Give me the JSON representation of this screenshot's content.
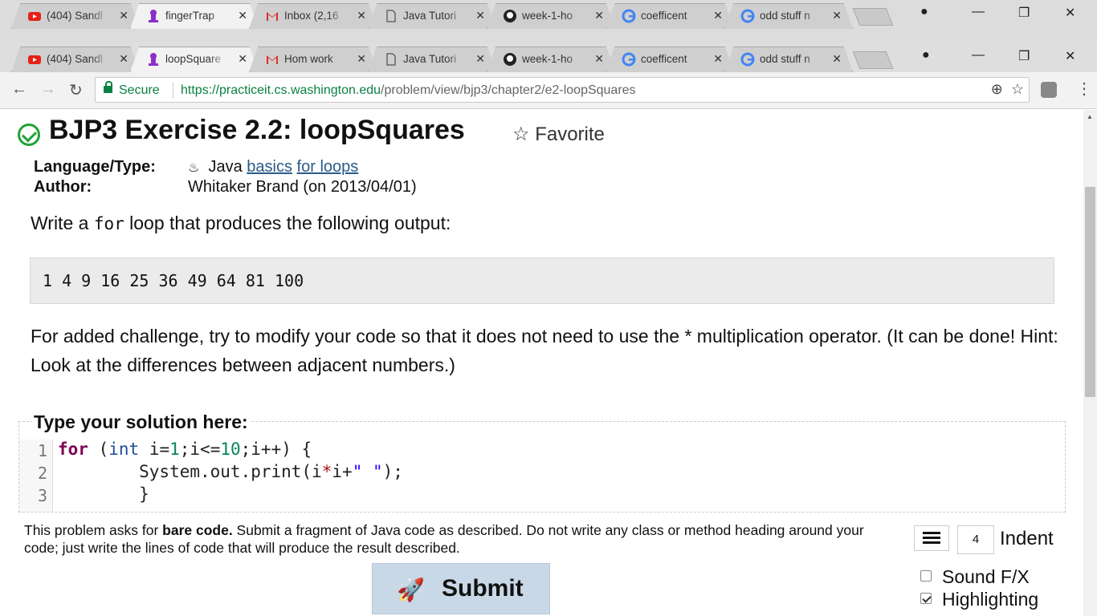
{
  "back_window": {
    "tabs": [
      {
        "title": "(404) Sandl",
        "icon": "youtube-icon"
      },
      {
        "title": "fingerTrap",
        "icon": "practiceit-icon",
        "active": true
      },
      {
        "title": "Inbox (2,16",
        "icon": "gmail-icon"
      },
      {
        "title": "Java Tutori",
        "icon": "page-icon"
      },
      {
        "title": "week-1-ho",
        "icon": "github-icon"
      },
      {
        "title": "coefficent",
        "icon": "google-icon"
      },
      {
        "title": "odd stuff n",
        "icon": "google-icon"
      }
    ]
  },
  "front_window": {
    "tabs": [
      {
        "title": "(404) Sandl",
        "icon": "youtube-icon"
      },
      {
        "title": "loopSquare",
        "icon": "practiceit-icon",
        "active": true
      },
      {
        "title": "Hom work",
        "icon": "gmail-icon"
      },
      {
        "title": "Java Tutori",
        "icon": "page-icon"
      },
      {
        "title": "week-1-ho",
        "icon": "github-icon"
      },
      {
        "title": "coefficent",
        "icon": "google-icon"
      },
      {
        "title": "odd stuff n",
        "icon": "google-icon"
      }
    ],
    "secure_label": "Secure",
    "url_scheme_host": "https://practiceit.cs.washington.edu",
    "url_path": "/problem/view/bjp3/chapter2/e2-loopSquares"
  },
  "page": {
    "title": "BJP3 Exercise 2.2: loopSquares",
    "favorite_label": "Favorite",
    "language_label": "Language/Type:",
    "language_value": "Java",
    "language_link1": "basics",
    "language_link2": "for loops",
    "author_label": "Author:",
    "author_value": "Whitaker Brand (on 2013/04/01)",
    "prompt_pre": "Write a ",
    "prompt_code": "for",
    "prompt_post": " loop that produces the following output:",
    "expected_output": "1 4 9 16 25 36 49 64 81 100",
    "challenge": "For added challenge, try to modify your code so that it does not need to use the * multiplication operator. (It can be done! Hint: Look at the differences between adjacent numbers.)",
    "solution_title": "Type your solution here:",
    "line_numbers": [
      "1",
      "2",
      "3"
    ],
    "code": {
      "l1_kw": "for",
      "l1_a": " (",
      "l1_ty": "int",
      "l1_b": " i=",
      "l1_n1": "1",
      "l1_c": ";i<=",
      "l1_n2": "10",
      "l1_d": ";i++) {",
      "l2_a": "        System.out.print(i",
      "l2_op": "*",
      "l2_b": "i+",
      "l2_str": "\" \"",
      "l2_c": ");",
      "l3": "        }"
    },
    "help_pre": "This problem asks for ",
    "help_bold": "bare code.",
    "help_post": " Submit a fragment of Java code as described. Do not write any class or method heading around your code; just write the lines of code that will produce the result described.",
    "indent_value": "4",
    "indent_label": "Indent",
    "submit_label": "Submit",
    "sound_label": "Sound F/X",
    "highlight_label": "Highlighting",
    "sound_checked": false,
    "highlight_checked": true
  }
}
